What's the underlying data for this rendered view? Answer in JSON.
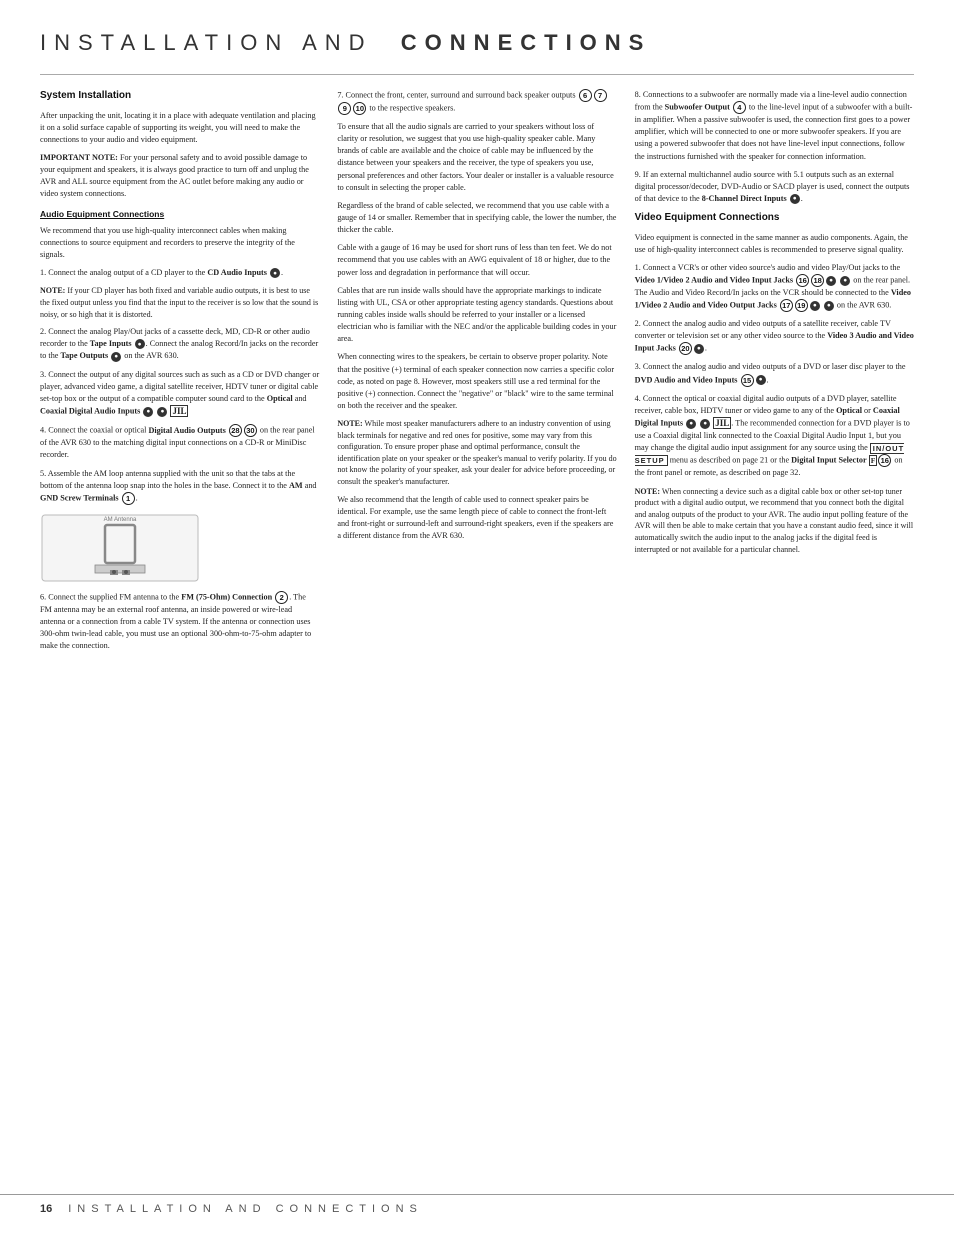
{
  "page": {
    "title": "INSTALLATION AND CONNECTIONS",
    "footer": {
      "page_num": "16",
      "title": "INSTALLATION AND CONNECTIONS"
    }
  },
  "sections": {
    "system_installation": {
      "title": "System Installation",
      "paragraphs": [
        "After unpacking the unit, locating it in a place with adequate ventilation and placing it on a solid surface capable of supporting its weight, you will need to make the connections to your audio and video equipment.",
        "IMPORTANT NOTE: For your personal safety and to avoid possible damage to your equipment and speakers, it is always good practice to turn off and unplug the AVR and ALL source equipment from the AC outlet before making any audio or video system connections."
      ],
      "audio_equipment": {
        "subtitle": "Audio Equipment Connections",
        "text": "We recommend that you use high-quality interconnect cables when making connections to source equipment and recorders to preserve the integrity of the signals.",
        "items": [
          "1. Connect the analog output of a CD player to the CD Audio Inputs ●.",
          "NOTE: If your CD player has both fixed and variable audio outputs, it is best to use the fixed output unless you find that the input to the receiver is so low that the sound is noisy, or so high that it is distorted.",
          "2. Connect the analog Play/Out jacks of a cassette deck, MD, CD-R or other audio recorder to the Tape Inputs ●. Connect the analog Record/In jacks on the recorder to the Tape Outputs ● on the AVR 630.",
          "3. Connect the output of any digital sources such as such as a CD or DVD changer or player, advanced video game, a digital satellite receiver, HDTV tuner or digital cable set-top box or the output of a compatible computer sound card to the Optical and Coaxial Digital Audio Inputs ● ● JIL",
          "4. Connect the coaxial or optical Digital Audio Outputs ❷❸⓪ on the rear panel of the AVR 630 to the matching digital input connections on a CD-R or MiniDisc recorder.",
          "5. Assemble the AM loop antenna supplied with the unit so that the tabs at the bottom of the antenna loop snap into the holes in the base. Connect it to the AM and GND Screw Terminals ❶.",
          "6. Connect the supplied FM antenna to the FM (75-Ohm) Connection ❷. The FM antenna may be an external roof antenna, an inside powered or wire-lead antenna or a connection from a cable TV system. If the antenna or connection uses 300-ohm twin-lead cable, you must use an optional 300-ohm-to-75-ohm adapter to make the connection."
        ]
      }
    },
    "middle_col": {
      "items": [
        "7. Connect the front, center, surround and surround back speaker outputs ❻❼❾⓪ to the respective speakers.",
        "To ensure that all the audio signals are carried to your speakers without loss of clarity or resolution, we suggest that you use high-quality speaker cable. Many brands of cable are available and the choice of cable may be influenced by the distance between your speakers and the receiver, the type of speakers you use, personal preferences and other factors. Your dealer or installer is a valuable resource to consult in selecting the proper cable.",
        "Regardless of the brand of cable selected, we recommend that you use cable with a gauge of 14 or smaller. Remember that in specifying cable, the lower the number, the thicker the cable.",
        "Cable with a gauge of 16 may be used for short runs of less than ten feet. We do not recommend that you use cables with an AWG equivalent of 18 or higher, due to the power loss and degradation in performance that will occur.",
        "Cables that are run inside walls should have the appropriate markings to indicate listing with UL, CSA or other appropriate testing agency standards. Questions about running cables inside walls should be referred to your installer or a licensed electrician who is familiar with the NEC and/or the applicable building codes in your area.",
        "When connecting wires to the speakers, be certain to observe proper polarity. Note that the positive (+) terminal of each speaker connection now carries a specific color code, as noted on page 8. However, most speakers still use a red terminal for the positive (+) connection. Connect the 'negative' or 'black' wire to the same terminal on both the receiver and the speaker.",
        "NOTE: While most speaker manufacturers adhere to an industry convention of using black terminals for negative and red ones for positive, some may vary from this configuration. To ensure proper phase and optimal performance, consult the identification plate on your speaker or the speaker's manual to verify polarity. If you do not know the polarity of your speaker, ask your dealer for advice before proceeding, or consult the speaker's manufacturer.",
        "We also recommend that the length of cable used to connect speaker pairs be identical. For example, use the same length piece of cable to connect the front-left and front-right or surround-left and surround-right speakers, even if the speakers are a different distance from the AVR 630."
      ]
    },
    "right_col": {
      "items": [
        "8. Connections to a subwoofer are normally made via a line-level audio connection from the Subwoofer Output ❹ to the line-level input of a subwoofer with a built-in amplifier. When a passive subwoofer is used, the connection first goes to a power amplifier, which will be connected to one or more subwoofer speakers. If you are using a powered subwoofer that does not have line-level input connections, follow the instructions furnished with the speaker for connection information.",
        "9. If an external multichannel audio source with 5.1 outputs such as an external digital processor/decoder, DVD-Audio or SACD player is used, connect the outputs of that device to the 8-Channel Direct Inputs ●.",
        "Video Equipment Connections",
        "Video equipment is connected in the same manner as audio components. Again, the use of high-quality interconnect cables is recommended to preserve signal quality.",
        "1. Connect a VCR's or other video source's audio and video Play/Out jacks to the Video 1/Video 2 Audio and Video Input Jacks ⑯⑱● ● on the rear panel. The Audio and Video Record/In jacks on the VCR should be connected to the Video 1/Video 2 Audio and Video Output Jacks ⑰⑲● ● on the AVR 630.",
        "2. Connect the analog audio and video outputs of a satellite receiver, cable TV converter or television set or any other video source to the Video 3 Audio and Video Input Jacks ⑳●.",
        "3. Connect the analog audio and video outputs of a DVD or laser disc player to the DVD Audio and Video Inputs ⑮●.",
        "4. Connect the optical or coaxial digital audio outputs of a DVD player, satellite receiver, cable box, HDTV tuner or video game to any of the Optical or Coaxial Digital Inputs ● ● JIL. The recommended connection for a DVD player is to use a Coaxial digital link connected to the Coaxial Digital Audio Input 1, but you may change the digital audio input assignment for any source using the IN/OUT SETUP menu as described on page 21 or the Digital Input Selector F⑯ on the front panel or remote, as described on page 32.",
        "NOTE: When connecting a device such as a digital cable box or other set-top tuner product with a digital audio output, we recommend that you connect both the digital and analog outputs of the product to your AVR. The audio input polling feature of the AVR will then be able to make certain that you have a constant audio feed, since it will automatically switch the audio input to the analog jacks if the digital feed is interrupted or not available for a particular channel."
      ]
    }
  }
}
